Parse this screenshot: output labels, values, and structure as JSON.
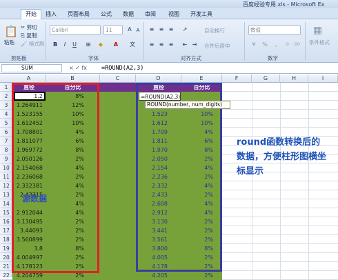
{
  "window": {
    "title": "百度经验专用.xls - Microsoft Ex"
  },
  "tabs": [
    "开始",
    "插入",
    "页面布局",
    "公式",
    "数据",
    "审阅",
    "视图",
    "开发工具"
  ],
  "ribbon": {
    "clipboard": {
      "paste": "粘贴",
      "cut": "剪切",
      "copy": "复制",
      "format_painter": "格式刷",
      "group_label": "剪贴板"
    },
    "font": {
      "name": "Calibri",
      "size": "11",
      "group_label": "字体"
    },
    "alignment": {
      "wrap": "自动换行",
      "merge": "合并后居中",
      "group_label": "对齐方式"
    },
    "number": {
      "format": "数值",
      "group_label": "数字"
    },
    "styles": {
      "cond": "条件格式"
    }
  },
  "formula_bar": {
    "name_box": "SUM",
    "fx": "× ✓ fx",
    "formula": "=ROUND(A2,3)"
  },
  "columns": [
    "A",
    "B",
    "C",
    "D",
    "E",
    "F",
    "G",
    "H",
    "I"
  ],
  "rows": [
    "1",
    "2",
    "3",
    "4",
    "5",
    "6",
    "7",
    "8",
    "9",
    "10",
    "11",
    "12",
    "13",
    "14",
    "15",
    "16",
    "17",
    "18",
    "19",
    "20",
    "21",
    "22"
  ],
  "headers": {
    "a": "直径",
    "b": "百分比",
    "d": "直径",
    "e": "百分比"
  },
  "editing_formula": "=ROUND(A2,3)",
  "tooltip": "ROUND(number, num_digits)",
  "source_data": [
    [
      "1.2",
      "8%"
    ],
    [
      "1.264911",
      "12%"
    ],
    [
      "1.523155",
      "10%"
    ],
    [
      "1.612452",
      "10%"
    ],
    [
      "1.708801",
      "4%"
    ],
    [
      "1.811077",
      "6%"
    ],
    [
      "1.969772",
      "8%"
    ],
    [
      "2.050126",
      "2%"
    ],
    [
      "2.154068",
      "4%"
    ],
    [
      "2.236068",
      "2%"
    ],
    [
      "2.332381",
      "4%"
    ],
    [
      "2.43315",
      "2%"
    ],
    [
      "",
      "4%"
    ],
    [
      "2.912044",
      "4%"
    ],
    [
      "3.130495",
      "2%"
    ],
    [
      "3.44093",
      "2%"
    ],
    [
      "3.560899",
      "2%"
    ],
    [
      "3.8",
      "8%"
    ],
    [
      "4.004997",
      "2%"
    ],
    [
      "4.178123",
      "2%"
    ],
    [
      "4.204759",
      "2%"
    ]
  ],
  "rounded_data": [
    [
      "",
      ""
    ],
    [
      "",
      ""
    ],
    [
      "1.523",
      "10%"
    ],
    [
      "1.612",
      "10%"
    ],
    [
      "1.709",
      "4%"
    ],
    [
      "1.811",
      "6%"
    ],
    [
      "1.970",
      "8%"
    ],
    [
      "2.050",
      "2%"
    ],
    [
      "2.154",
      "4%"
    ],
    [
      "2.236",
      "2%"
    ],
    [
      "2.332",
      "4%"
    ],
    [
      "2.433",
      "2%"
    ],
    [
      "2.608",
      "4%"
    ],
    [
      "2.912",
      "4%"
    ],
    [
      "3.130",
      "2%"
    ],
    [
      "3.441",
      "2%"
    ],
    [
      "3.561",
      "2%"
    ],
    [
      "3.800",
      "8%"
    ],
    [
      "4.005",
      "2%"
    ],
    [
      "4.178",
      "2%"
    ],
    [
      "4.205",
      "2%"
    ]
  ],
  "source_label": "源数据",
  "annotation": "round函数转换后的数据，方便柱形图横坐标显示"
}
